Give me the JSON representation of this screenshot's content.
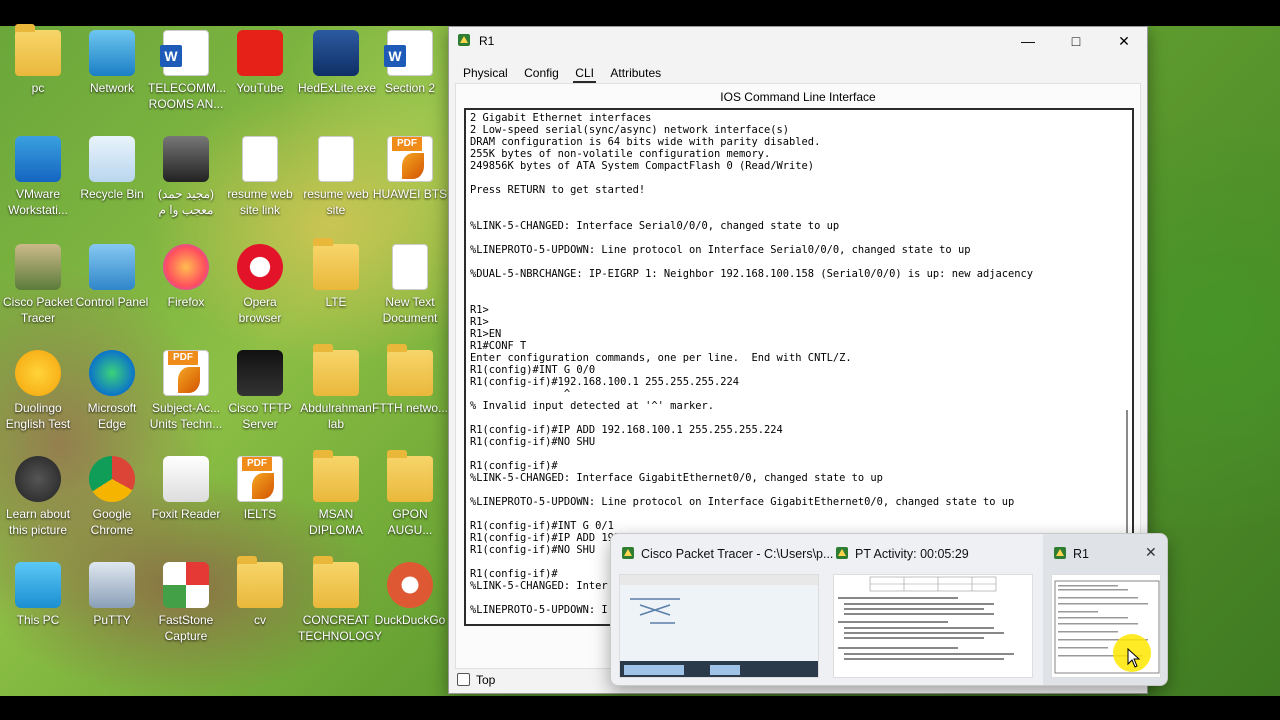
{
  "desktop": {
    "icons": [
      {
        "label": "pc",
        "icon": "folder-icon"
      },
      {
        "label": "Network",
        "icon": "network-icon"
      },
      {
        "label": "TELECOMM... ROOMS AN...",
        "icon": "word-doc-icon"
      },
      {
        "label": "YouTube",
        "icon": "youtube-icon"
      },
      {
        "label": "HedExLite.exe",
        "icon": "hedex-icon"
      },
      {
        "label": "Section 2",
        "icon": "word-doc-icon"
      },
      {
        "label": "VMware Workstati...",
        "icon": "vmware-icon"
      },
      {
        "label": "Recycle Bin",
        "icon": "recycle-bin-icon"
      },
      {
        "label": "(مجيد حمد) معجب وا م",
        "icon": "photo-icon"
      },
      {
        "label": "resume web site link",
        "icon": "text-file-icon"
      },
      {
        "label": "resume web site",
        "icon": "text-file-icon"
      },
      {
        "label": "HUAWEI BTS",
        "icon": "pdf-icon"
      },
      {
        "label": "Cisco Packet Tracer",
        "icon": "packet-tracer-icon"
      },
      {
        "label": "Control Panel",
        "icon": "control-panel-icon"
      },
      {
        "label": "Firefox",
        "icon": "firefox-icon"
      },
      {
        "label": "Opera browser",
        "icon": "opera-icon"
      },
      {
        "label": "LTE",
        "icon": "folder-icon"
      },
      {
        "label": "New Text Document",
        "icon": "text-file-icon"
      },
      {
        "label": "Duolingo English Test",
        "icon": "duolingo-icon"
      },
      {
        "label": "Microsoft Edge",
        "icon": "edge-icon"
      },
      {
        "label": "Subject-Ac... Units Techn...",
        "icon": "pdf-icon"
      },
      {
        "label": "Cisco TFTP Server",
        "icon": "tftp-icon"
      },
      {
        "label": "Abdulrahman lab",
        "icon": "folder-icon"
      },
      {
        "label": "FTTH netwo...",
        "icon": "folder-icon"
      },
      {
        "label": "Learn about this picture",
        "icon": "learn-picture-icon"
      },
      {
        "label": "Google Chrome",
        "icon": "chrome-icon"
      },
      {
        "label": "Foxit Reader",
        "icon": "foxit-icon"
      },
      {
        "label": "IELTS",
        "icon": "pdf-icon"
      },
      {
        "label": "MSAN DIPLOMA",
        "icon": "folder-icon"
      },
      {
        "label": "GPON AUGU...",
        "icon": "folder-icon"
      },
      {
        "label": "This PC",
        "icon": "this-pc-icon"
      },
      {
        "label": "PuTTY",
        "icon": "putty-icon"
      },
      {
        "label": "FastStone Capture",
        "icon": "faststone-icon"
      },
      {
        "label": "cv",
        "icon": "pdf-folder-icon"
      },
      {
        "label": "CONCREAT TECHNOLOGY",
        "icon": "folder-icon"
      },
      {
        "label": "DuckDuckGo",
        "icon": "duckduckgo-icon"
      }
    ]
  },
  "window": {
    "title": "R1",
    "tabs": [
      "Physical",
      "Config",
      "CLI",
      "Attributes"
    ],
    "active_tab": "CLI",
    "panel_title": "IOS Command Line Interface",
    "top_checkbox_label": "Top",
    "cli_lines": [
      "2 Gigabit Ethernet interfaces",
      "2 Low-speed serial(sync/async) network interface(s)",
      "DRAM configuration is 64 bits wide with parity disabled.",
      "255K bytes of non-volatile configuration memory.",
      "249856K bytes of ATA System CompactFlash 0 (Read/Write)",
      "",
      "Press RETURN to get started!",
      "",
      "",
      "%LINK-5-CHANGED: Interface Serial0/0/0, changed state to up",
      "",
      "%LINEPROTO-5-UPDOWN: Line protocol on Interface Serial0/0/0, changed state to up",
      "",
      "%DUAL-5-NBRCHANGE: IP-EIGRP 1: Neighbor 192.168.100.158 (Serial0/0/0) is up: new adjacency",
      "",
      "",
      "R1>",
      "R1>",
      "R1>EN",
      "R1#CONF T",
      "Enter configuration commands, one per line.  End with CNTL/Z.",
      "R1(config)#INT G 0/0",
      "R1(config-if)#192.168.100.1 255.255.255.224",
      "               ^",
      "% Invalid input detected at '^' marker.",
      "",
      "R1(config-if)#IP ADD 192.168.100.1 255.255.255.224",
      "R1(config-if)#NO SHU",
      "",
      "R1(config-if)#",
      "%LINK-5-CHANGED: Interface GigabitEthernet0/0, changed state to up",
      "",
      "%LINEPROTO-5-UPDOWN: Line protocol on Interface GigabitEthernet0/0, changed state to up",
      "",
      "R1(config-if)#INT G 0/1",
      "R1(config-if)#IP ADD 192.168.100.33 255.255.255.224",
      "R1(config-if)#NO SHU",
      "",
      "R1(config-if)#",
      "%LINK-5-CHANGED: Inter",
      "",
      "%LINEPROTO-5-UPDOWN: I"
    ]
  },
  "taskbar_preview": {
    "items": [
      {
        "title": "Cisco Packet Tracer - C:\\Users\\p...",
        "icon": "packet-tracer-icon"
      },
      {
        "title": "PT Activity: 00:05:29",
        "icon": "packet-tracer-icon"
      },
      {
        "title": "R1",
        "icon": "packet-tracer-icon",
        "close_glyph": "✕"
      }
    ]
  },
  "colors": {
    "window_bg": "#f3f3f3",
    "cli_border": "#2b2b2b",
    "cursor_highlight": "#ffe600"
  }
}
